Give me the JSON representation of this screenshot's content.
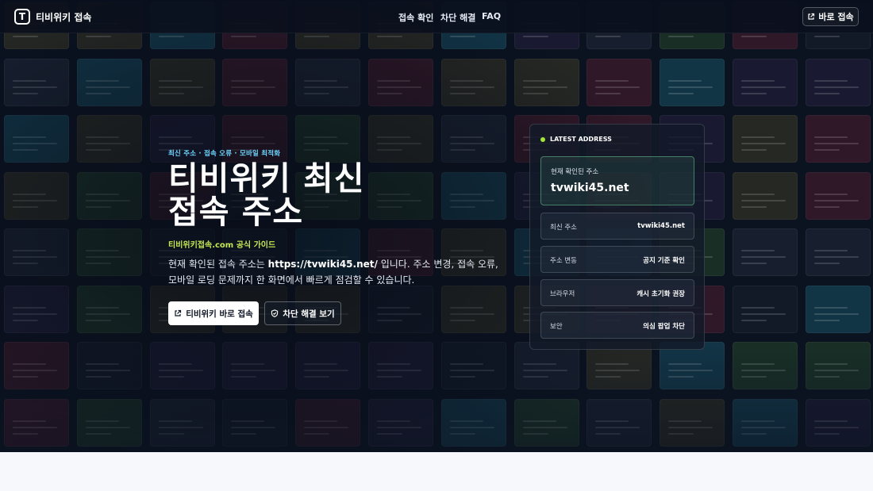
{
  "header": {
    "logo_letter": "T",
    "brand": "티비위키 접속",
    "nav": [
      "접속 확인",
      "차단 해결",
      "FAQ"
    ],
    "cta_label": "바로 접속"
  },
  "hero": {
    "eyebrow": "최신 주소 · 접속 오류 · 모바일 최적화",
    "title_line1": "티비위키 최신",
    "title_line2": "접속 주소",
    "domain_guide": "티비위키접속.com 공식 가이드",
    "desc_before": "현재 확인된 접속 주소는 ",
    "desc_url": "https://tvwiki45.net/",
    "desc_after": " 입니다. 주소 변경, 접속 오류, 모바일 로딩 문제까지 한 화면에서 빠르게 점검할 수 있습니다.",
    "primary_button": "티비위키 바로 접속",
    "secondary_button": "차단 해결 보기"
  },
  "card": {
    "badge": "LATEST ADDRESS",
    "current_label": "현재 확인된 주소",
    "current_value": "tvwiki45.net",
    "rows": [
      {
        "key": "최신 주소",
        "value": "tvwiki45.net"
      },
      {
        "key": "주소 변동",
        "value": "공지 기준 확인"
      },
      {
        "key": "브라우저",
        "value": "캐시 초기화 권장"
      },
      {
        "key": "보안",
        "value": "의심 팝업 차단"
      }
    ]
  },
  "icons": {
    "logo": "logo-icon",
    "external": "external-link-icon",
    "shield": "shield-icon",
    "status": "status-dot-icon"
  },
  "colors": {
    "background": "#0b1220",
    "accent_cyan": "#6fd6ff",
    "accent_lime": "#c4e852",
    "status_green": "#a3e635"
  }
}
